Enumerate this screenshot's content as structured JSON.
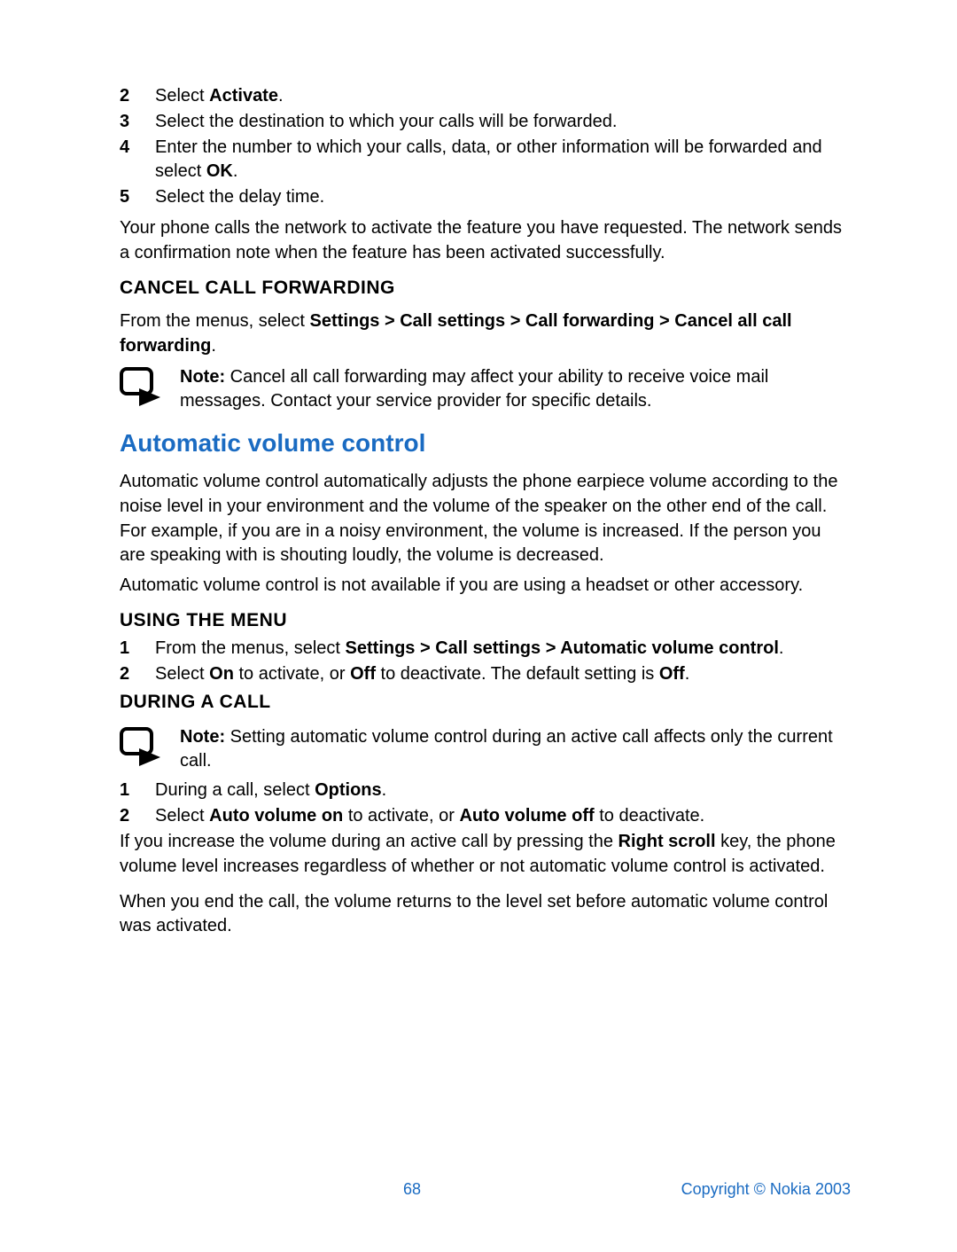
{
  "steps_top": [
    {
      "n": "2",
      "before": "Select ",
      "bold": "Activate",
      "after": "."
    },
    {
      "n": "3",
      "before": "Select the destination to which your calls will be forwarded.",
      "bold": "",
      "after": ""
    },
    {
      "n": "4",
      "before": "Enter the number to which your calls, data, or other information will be forwarded and select ",
      "bold": "OK",
      "after": "."
    },
    {
      "n": "5",
      "before": "Select the delay time.",
      "bold": "",
      "after": ""
    }
  ],
  "para_top": "Your phone calls the network to activate the feature you have requested. The network sends a confirmation note when the feature has been activated successfully.",
  "cancel_heading": "CANCEL CALL FORWARDING",
  "cancel_para_before": "From the menus, select ",
  "cancel_para_bold": "Settings > Call settings > Call forwarding > Cancel all call forwarding",
  "cancel_para_after": ".",
  "note1_bold": "Note:",
  "note1_text": " Cancel all call forwarding may affect your ability to receive voice mail messages. Contact your service provider for specific details.",
  "section_heading": "Automatic volume control",
  "avc_para1": "Automatic volume control automatically adjusts the phone earpiece volume according to the noise level in your environment and the volume of the speaker on the other end of the call. For example, if you are in a noisy environment, the volume is increased. If the person you are speaking with is shouting loudly, the volume is decreased.",
  "avc_para2": "Automatic volume control is not available if you are using a headset or other accessory.",
  "using_heading": "USING THE MENU",
  "using_steps": [
    {
      "n": "1",
      "parts": [
        {
          "t": "From the menus, select ",
          "b": false
        },
        {
          "t": "Settings > Call settings > Automatic volume control",
          "b": true
        },
        {
          "t": ".",
          "b": false
        }
      ]
    },
    {
      "n": "2",
      "parts": [
        {
          "t": "Select ",
          "b": false
        },
        {
          "t": "On",
          "b": true
        },
        {
          "t": " to activate, or ",
          "b": false
        },
        {
          "t": "Off",
          "b": true
        },
        {
          "t": " to deactivate. The default setting is ",
          "b": false
        },
        {
          "t": "Off",
          "b": true
        },
        {
          "t": ".",
          "b": false
        }
      ]
    }
  ],
  "during_heading": "DURING A CALL",
  "note2_bold": "Note:",
  "note2_text": " Setting automatic volume control during an active call affects only the current call.",
  "during_steps": [
    {
      "n": "1",
      "parts": [
        {
          "t": "During a call, select ",
          "b": false
        },
        {
          "t": "Options",
          "b": true
        },
        {
          "t": ".",
          "b": false
        }
      ]
    },
    {
      "n": "2",
      "parts": [
        {
          "t": "Select ",
          "b": false
        },
        {
          "t": "Auto volume on",
          "b": true
        },
        {
          "t": " to activate, or ",
          "b": false
        },
        {
          "t": "Auto volume off",
          "b": true
        },
        {
          "t": " to deactivate.",
          "b": false
        }
      ]
    }
  ],
  "during_para1_parts": [
    {
      "t": "If you increase the volume during an active call by pressing the ",
      "b": false
    },
    {
      "t": "Right scroll",
      "b": true
    },
    {
      "t": " key, the phone volume level increases regardless of whether or not automatic volume control is activated.",
      "b": false
    }
  ],
  "during_para2": "When you end the call, the volume returns to the level set before automatic volume control was activated.",
  "page_number": "68",
  "copyright": "Copyright © Nokia 2003"
}
